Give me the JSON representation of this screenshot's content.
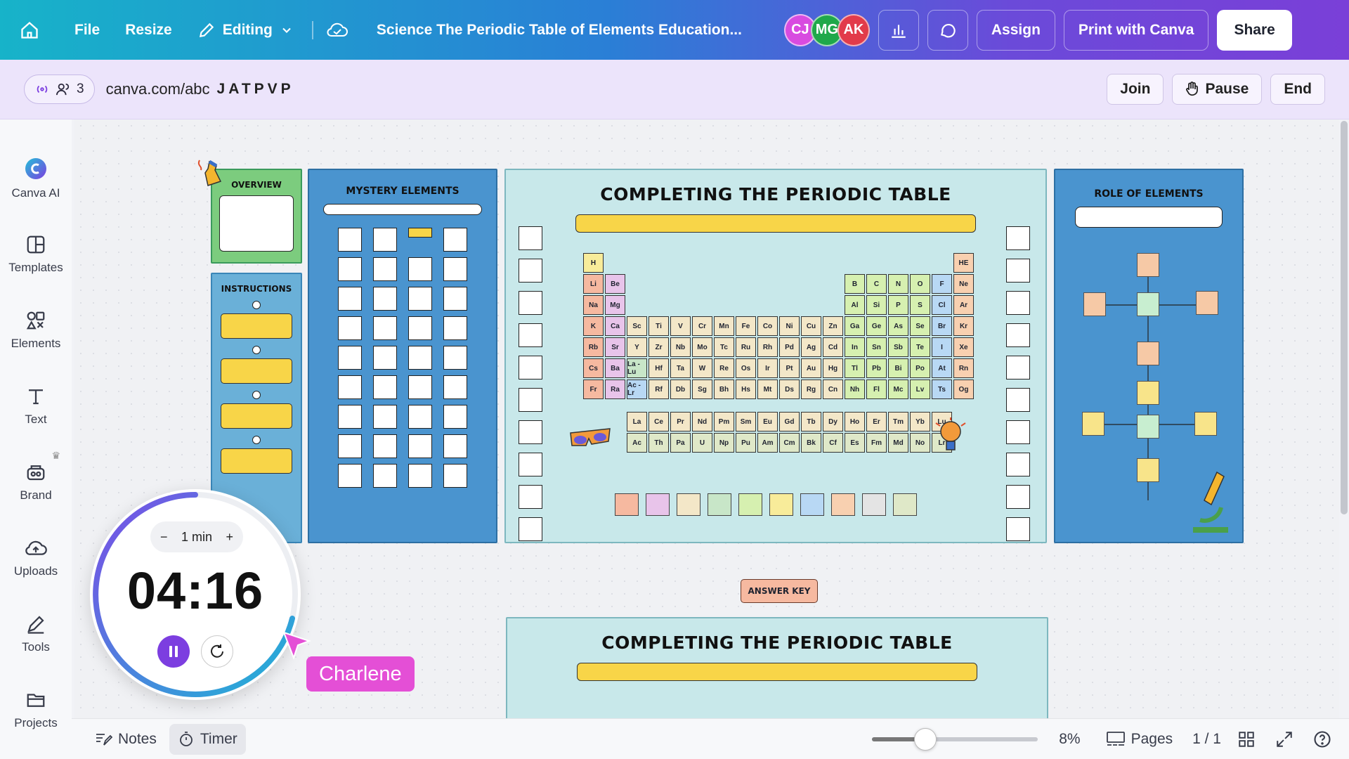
{
  "topbar": {
    "file_label": "File",
    "resize_label": "Resize",
    "editing_label": "Editing",
    "title": "Science The Periodic Table of Elements Education...",
    "avatars": [
      {
        "initials": "CJ",
        "color": "#d84be0"
      },
      {
        "initials": "MG",
        "color": "#1fa84a"
      },
      {
        "initials": "AK",
        "color": "#e23b4a"
      }
    ],
    "assign_label": "Assign",
    "print_label": "Print with Canva",
    "share_label": "Share"
  },
  "livebar": {
    "participant_count": "3",
    "url": "canva.com/abc",
    "code": "JATPVP",
    "join_label": "Join",
    "pause_label": "Pause",
    "end_label": "End"
  },
  "sidebar": {
    "items": [
      {
        "label": "Canva AI",
        "icon": "canva-ai-icon"
      },
      {
        "label": "Templates",
        "icon": "templates-icon"
      },
      {
        "label": "Elements",
        "icon": "elements-icon"
      },
      {
        "label": "Text",
        "icon": "text-icon"
      },
      {
        "label": "Brand",
        "icon": "brand-icon"
      },
      {
        "label": "Uploads",
        "icon": "uploads-icon"
      },
      {
        "label": "Tools",
        "icon": "tools-icon"
      },
      {
        "label": "Projects",
        "icon": "projects-icon"
      }
    ]
  },
  "canvas": {
    "overview_title": "OVERVIEW",
    "instructions_title": "INSTRUCTIONS",
    "mystery_title": "MYSTERY ELEMENTS",
    "periodic_title": "COMPLETING THE PERIODIC TABLE",
    "role_title": "ROLE OF ELEMENTS",
    "answer_key_label": "ANSWER KEY",
    "bottom_title": "COMPLETING THE PERIODIC TABLE",
    "periodic_rows": [
      [
        "H",
        "",
        "",
        "",
        "",
        "",
        "",
        "",
        "",
        "",
        "",
        "",
        "",
        "",
        "",
        "",
        "",
        "HE"
      ],
      [
        "Li",
        "Be",
        "",
        "",
        "",
        "",
        "",
        "",
        "",
        "",
        "",
        "",
        "B",
        "C",
        "N",
        "O",
        "F",
        "Ne"
      ],
      [
        "Na",
        "Mg",
        "",
        "",
        "",
        "",
        "",
        "",
        "",
        "",
        "",
        "",
        "Al",
        "Si",
        "P",
        "S",
        "Cl",
        "Ar"
      ],
      [
        "K",
        "Ca",
        "Sc",
        "Ti",
        "V",
        "Cr",
        "Mn",
        "Fe",
        "Co",
        "Ni",
        "Cu",
        "Zn",
        "Ga",
        "Ge",
        "As",
        "Se",
        "Br",
        "Kr"
      ],
      [
        "Rb",
        "Sr",
        "Y",
        "Zr",
        "Nb",
        "Mo",
        "Tc",
        "Ru",
        "Rh",
        "Pd",
        "Ag",
        "Cd",
        "In",
        "Sn",
        "Sb",
        "Te",
        "I",
        "Xe"
      ],
      [
        "Cs",
        "Ba",
        "La - Lu",
        "Hf",
        "Ta",
        "W",
        "Re",
        "Os",
        "Ir",
        "Pt",
        "Au",
        "Hg",
        "Tl",
        "Pb",
        "Bi",
        "Po",
        "At",
        "Rn"
      ],
      [
        "Fr",
        "Ra",
        "Ac - Lr",
        "Rf",
        "Db",
        "Sg",
        "Bh",
        "Hs",
        "Mt",
        "Ds",
        "Rg",
        "Cn",
        "Nh",
        "Fl",
        "Mc",
        "Lv",
        "Ts",
        "Og"
      ]
    ],
    "lanthanides": [
      "La",
      "Ce",
      "Pr",
      "Nd",
      "Pm",
      "Sm",
      "Eu",
      "Gd",
      "Tb",
      "Dy",
      "Ho",
      "Er",
      "Tm",
      "Yb",
      "Lu"
    ],
    "actinides": [
      "Ac",
      "Th",
      "Pa",
      "U",
      "Np",
      "Pu",
      "Am",
      "Cm",
      "Bk",
      "Cf",
      "Es",
      "Fm",
      "Md",
      "No",
      "Lr"
    ],
    "legend_colors": [
      "#f6b9a0",
      "#e8c4ea",
      "#f3e7c8",
      "#c8e6c8",
      "#d6f0b0",
      "#f8ec9a",
      "#b8d8f4",
      "#f8d0b0",
      "#e4e4e4",
      "#dfe8c8"
    ]
  },
  "timer": {
    "step_label": "1 min",
    "minus": "−",
    "plus": "+",
    "time": "04:16"
  },
  "cursor": {
    "name": "Charlene",
    "color": "#e44fd6"
  },
  "bottombar": {
    "notes_label": "Notes",
    "timer_label": "Timer",
    "zoom_percent": 8,
    "zoom_label": "8%",
    "pages_label": "Pages",
    "page_count": "1 / 1"
  },
  "colors": {
    "accent": "#7c3ee0",
    "timer_ring_start": "#7c4ce6",
    "timer_ring_end": "#1fb5d6"
  }
}
